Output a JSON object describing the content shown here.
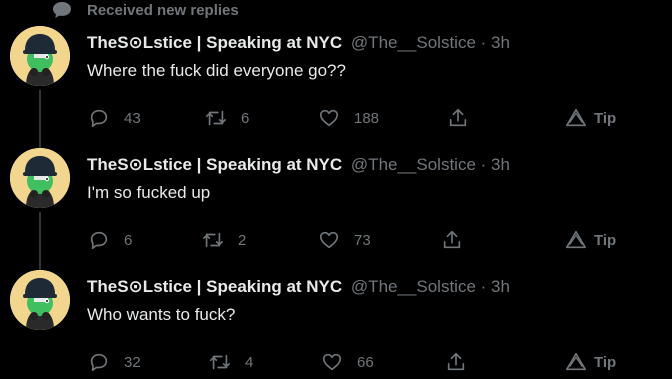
{
  "notice": {
    "text": "Received new replies",
    "icon": "speech-bubble-icon"
  },
  "colors": {
    "background": "#000000",
    "text": "#e7e9ea",
    "muted": "#71767b",
    "thread_line": "#333639"
  },
  "tweets": [
    {
      "name": "TheS⊙Lstice | Speaking at NYC",
      "handle": "@The__Solstice",
      "time": "3h",
      "text": "Where the fuck did everyone go??",
      "replies": "43",
      "retweets": "6",
      "likes": "188",
      "tip": "Tip"
    },
    {
      "name": "TheS⊙Lstice | Speaking at NYC",
      "handle": "@The__Solstice",
      "time": "3h",
      "text": "I'm so fucked up",
      "replies": "6",
      "retweets": "2",
      "likes": "73",
      "tip": "Tip"
    },
    {
      "name": "TheS⊙Lstice | Speaking at NYC",
      "handle": "@The__Solstice",
      "time": "3h",
      "text": "Who wants to fuck?",
      "replies": "32",
      "retweets": "4",
      "likes": "66",
      "tip": "Tip"
    }
  ]
}
